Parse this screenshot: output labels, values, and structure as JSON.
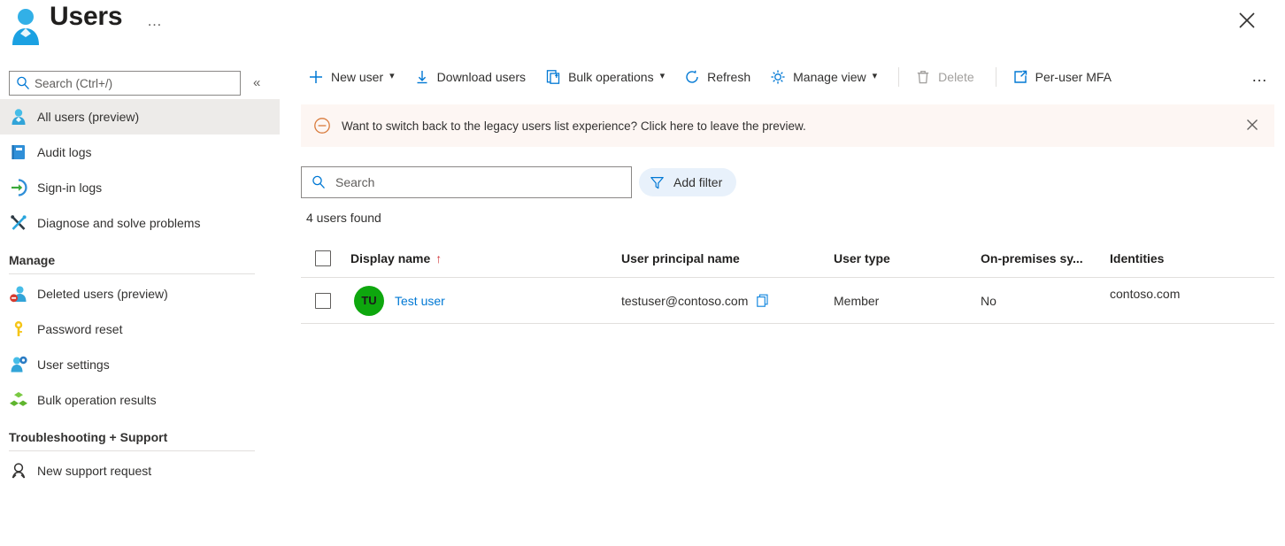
{
  "header": {
    "title": "Users",
    "ellipsis": "…",
    "user_icon": "user-icon",
    "close_icon": "close-icon"
  },
  "sidebar": {
    "search": {
      "placeholder": "Search (Ctrl+/)",
      "value": ""
    },
    "collapse_label": "«",
    "items": [
      {
        "label": "All users (preview)",
        "icon": "user-icon",
        "selected": true
      },
      {
        "label": "Audit logs",
        "icon": "book-icon",
        "selected": false
      },
      {
        "label": "Sign-in logs",
        "icon": "sign-in-icon",
        "selected": false
      },
      {
        "label": "Diagnose and solve problems",
        "icon": "wrench-screwdriver-icon",
        "selected": false
      }
    ],
    "manage_section": "Manage",
    "manage_items": [
      {
        "label": "Deleted users (preview)",
        "icon": "user-deleted-icon"
      },
      {
        "label": "Password reset",
        "icon": "key-icon"
      },
      {
        "label": "User settings",
        "icon": "user-gear-icon"
      },
      {
        "label": "Bulk operation results",
        "icon": "cubes-icon"
      }
    ],
    "support_section": "Troubleshooting + Support",
    "support_items": [
      {
        "label": "New support request",
        "icon": "support-person-icon"
      }
    ]
  },
  "toolbar": {
    "new_user": "New user",
    "download_users": "Download users",
    "bulk_operations": "Bulk operations",
    "refresh": "Refresh",
    "manage_view": "Manage view",
    "delete": "Delete",
    "per_user_mfa": "Per-user MFA",
    "overflow": "…",
    "delete_disabled": true
  },
  "banner": {
    "text": "Want to switch back to the legacy users list experience? Click here to leave the preview.",
    "icon": "minus-circle-icon",
    "close_icon": "close-icon",
    "background": "#fdf6f3",
    "icon_color": "#d97b3c"
  },
  "filters": {
    "search": {
      "placeholder": "Search",
      "value": ""
    },
    "add_filter": "Add filter",
    "add_filter_icon": "funnel-icon",
    "add_filter_bg": "#e8f1fb"
  },
  "result_count": "4 users found",
  "table": {
    "columns": [
      "Display name",
      "User principal name",
      "User type",
      "On-premises sy...",
      "Identities"
    ],
    "sort_column": "Display name",
    "sort_indicator": "↑",
    "rows": [
      {
        "checked": false,
        "initials": "TU",
        "avatar_color": "#0ea70e",
        "display_name": "Test user",
        "user_principal_name": "testuser@contoso.com",
        "copy_icon": "copy-icon",
        "user_type": "Member",
        "on_premises_sync": "No",
        "identities": "contoso.com"
      }
    ]
  },
  "colors": {
    "accent": "#0078d4",
    "link": "#0078d4",
    "selected_nav_bg": "#edebe9",
    "border": "#e1dfdd",
    "sort_arrow": "#d13438"
  }
}
